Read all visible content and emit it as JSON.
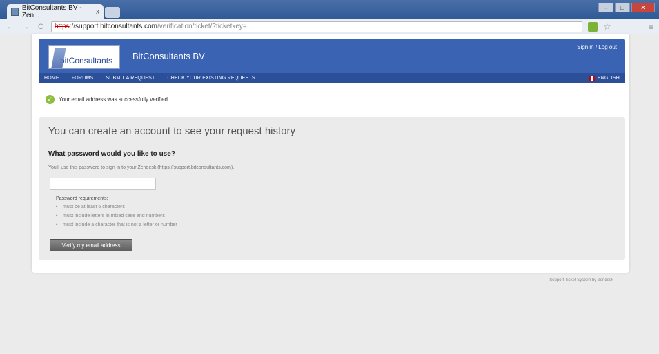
{
  "browser": {
    "tab_title": "BitConsultants BV - Zen...",
    "tab_close": "x",
    "address": {
      "scheme": "https",
      "separator": "://",
      "host": "support.bitconsultants.com",
      "path": "/verification/ticket/?ticketkey=..."
    },
    "back_icon": "arrow-left-icon",
    "forward_icon": "arrow-right-icon",
    "reload_icon": "reload-icon"
  },
  "header": {
    "logo_text": "bitConsultants",
    "company_name": "BitConsultants BV",
    "signin_label": "Sign in / Log out"
  },
  "nav": {
    "items": [
      "HOME",
      "FORUMS",
      "SUBMIT A REQUEST",
      "CHECK YOUR EXISTING REQUESTS"
    ],
    "language": "ENGLISH"
  },
  "notice": {
    "text": "Your email address was successfully verified"
  },
  "panel": {
    "title": "You can create an account to see your request history",
    "question": "What password would you like to use?",
    "hint": "You'll use this password to sign in to your Zendesk (https://support.bitconsultants.com).",
    "password_placeholder": "",
    "requirements_title": "Password requirements:",
    "requirements": [
      "must be at least 5 characters",
      "must include letters in mixed case and numbers",
      "must include a character that is not a letter or number"
    ],
    "button_label": "Verify my email address"
  },
  "footer": {
    "text": "Support Ticket System by Zendesk"
  },
  "colors": {
    "header_blue": "#3b63b3",
    "nav_blue": "#2c4f99",
    "success_green": "#8cbf3f"
  }
}
